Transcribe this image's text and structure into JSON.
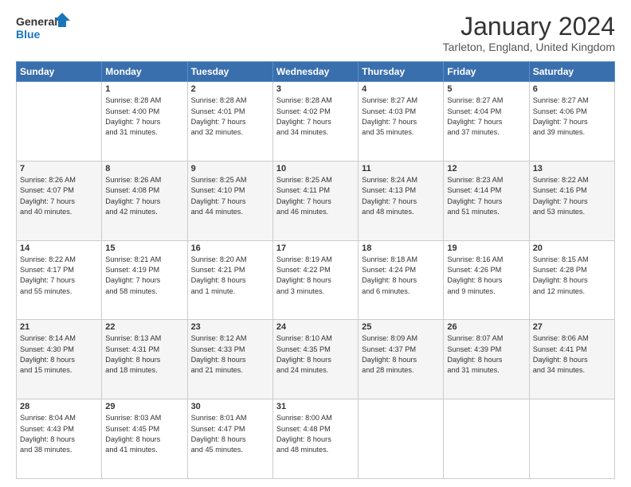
{
  "logo": {
    "text_general": "General",
    "text_blue": "Blue"
  },
  "header": {
    "month_title": "January 2024",
    "location": "Tarleton, England, United Kingdom"
  },
  "weekdays": [
    "Sunday",
    "Monday",
    "Tuesday",
    "Wednesday",
    "Thursday",
    "Friday",
    "Saturday"
  ],
  "weeks": [
    [
      {
        "day": "",
        "info": ""
      },
      {
        "day": "1",
        "info": "Sunrise: 8:28 AM\nSunset: 4:00 PM\nDaylight: 7 hours\nand 31 minutes."
      },
      {
        "day": "2",
        "info": "Sunrise: 8:28 AM\nSunset: 4:01 PM\nDaylight: 7 hours\nand 32 minutes."
      },
      {
        "day": "3",
        "info": "Sunrise: 8:28 AM\nSunset: 4:02 PM\nDaylight: 7 hours\nand 34 minutes."
      },
      {
        "day": "4",
        "info": "Sunrise: 8:27 AM\nSunset: 4:03 PM\nDaylight: 7 hours\nand 35 minutes."
      },
      {
        "day": "5",
        "info": "Sunrise: 8:27 AM\nSunset: 4:04 PM\nDaylight: 7 hours\nand 37 minutes."
      },
      {
        "day": "6",
        "info": "Sunrise: 8:27 AM\nSunset: 4:06 PM\nDaylight: 7 hours\nand 39 minutes."
      }
    ],
    [
      {
        "day": "7",
        "info": "Sunrise: 8:26 AM\nSunset: 4:07 PM\nDaylight: 7 hours\nand 40 minutes."
      },
      {
        "day": "8",
        "info": "Sunrise: 8:26 AM\nSunset: 4:08 PM\nDaylight: 7 hours\nand 42 minutes."
      },
      {
        "day": "9",
        "info": "Sunrise: 8:25 AM\nSunset: 4:10 PM\nDaylight: 7 hours\nand 44 minutes."
      },
      {
        "day": "10",
        "info": "Sunrise: 8:25 AM\nSunset: 4:11 PM\nDaylight: 7 hours\nand 46 minutes."
      },
      {
        "day": "11",
        "info": "Sunrise: 8:24 AM\nSunset: 4:13 PM\nDaylight: 7 hours\nand 48 minutes."
      },
      {
        "day": "12",
        "info": "Sunrise: 8:23 AM\nSunset: 4:14 PM\nDaylight: 7 hours\nand 51 minutes."
      },
      {
        "day": "13",
        "info": "Sunrise: 8:22 AM\nSunset: 4:16 PM\nDaylight: 7 hours\nand 53 minutes."
      }
    ],
    [
      {
        "day": "14",
        "info": "Sunrise: 8:22 AM\nSunset: 4:17 PM\nDaylight: 7 hours\nand 55 minutes."
      },
      {
        "day": "15",
        "info": "Sunrise: 8:21 AM\nSunset: 4:19 PM\nDaylight: 7 hours\nand 58 minutes."
      },
      {
        "day": "16",
        "info": "Sunrise: 8:20 AM\nSunset: 4:21 PM\nDaylight: 8 hours\nand 1 minute."
      },
      {
        "day": "17",
        "info": "Sunrise: 8:19 AM\nSunset: 4:22 PM\nDaylight: 8 hours\nand 3 minutes."
      },
      {
        "day": "18",
        "info": "Sunrise: 8:18 AM\nSunset: 4:24 PM\nDaylight: 8 hours\nand 6 minutes."
      },
      {
        "day": "19",
        "info": "Sunrise: 8:16 AM\nSunset: 4:26 PM\nDaylight: 8 hours\nand 9 minutes."
      },
      {
        "day": "20",
        "info": "Sunrise: 8:15 AM\nSunset: 4:28 PM\nDaylight: 8 hours\nand 12 minutes."
      }
    ],
    [
      {
        "day": "21",
        "info": "Sunrise: 8:14 AM\nSunset: 4:30 PM\nDaylight: 8 hours\nand 15 minutes."
      },
      {
        "day": "22",
        "info": "Sunrise: 8:13 AM\nSunset: 4:31 PM\nDaylight: 8 hours\nand 18 minutes."
      },
      {
        "day": "23",
        "info": "Sunrise: 8:12 AM\nSunset: 4:33 PM\nDaylight: 8 hours\nand 21 minutes."
      },
      {
        "day": "24",
        "info": "Sunrise: 8:10 AM\nSunset: 4:35 PM\nDaylight: 8 hours\nand 24 minutes."
      },
      {
        "day": "25",
        "info": "Sunrise: 8:09 AM\nSunset: 4:37 PM\nDaylight: 8 hours\nand 28 minutes."
      },
      {
        "day": "26",
        "info": "Sunrise: 8:07 AM\nSunset: 4:39 PM\nDaylight: 8 hours\nand 31 minutes."
      },
      {
        "day": "27",
        "info": "Sunrise: 8:06 AM\nSunset: 4:41 PM\nDaylight: 8 hours\nand 34 minutes."
      }
    ],
    [
      {
        "day": "28",
        "info": "Sunrise: 8:04 AM\nSunset: 4:43 PM\nDaylight: 8 hours\nand 38 minutes."
      },
      {
        "day": "29",
        "info": "Sunrise: 8:03 AM\nSunset: 4:45 PM\nDaylight: 8 hours\nand 41 minutes."
      },
      {
        "day": "30",
        "info": "Sunrise: 8:01 AM\nSunset: 4:47 PM\nDaylight: 8 hours\nand 45 minutes."
      },
      {
        "day": "31",
        "info": "Sunrise: 8:00 AM\nSunset: 4:48 PM\nDaylight: 8 hours\nand 48 minutes."
      },
      {
        "day": "",
        "info": ""
      },
      {
        "day": "",
        "info": ""
      },
      {
        "day": "",
        "info": ""
      }
    ]
  ]
}
